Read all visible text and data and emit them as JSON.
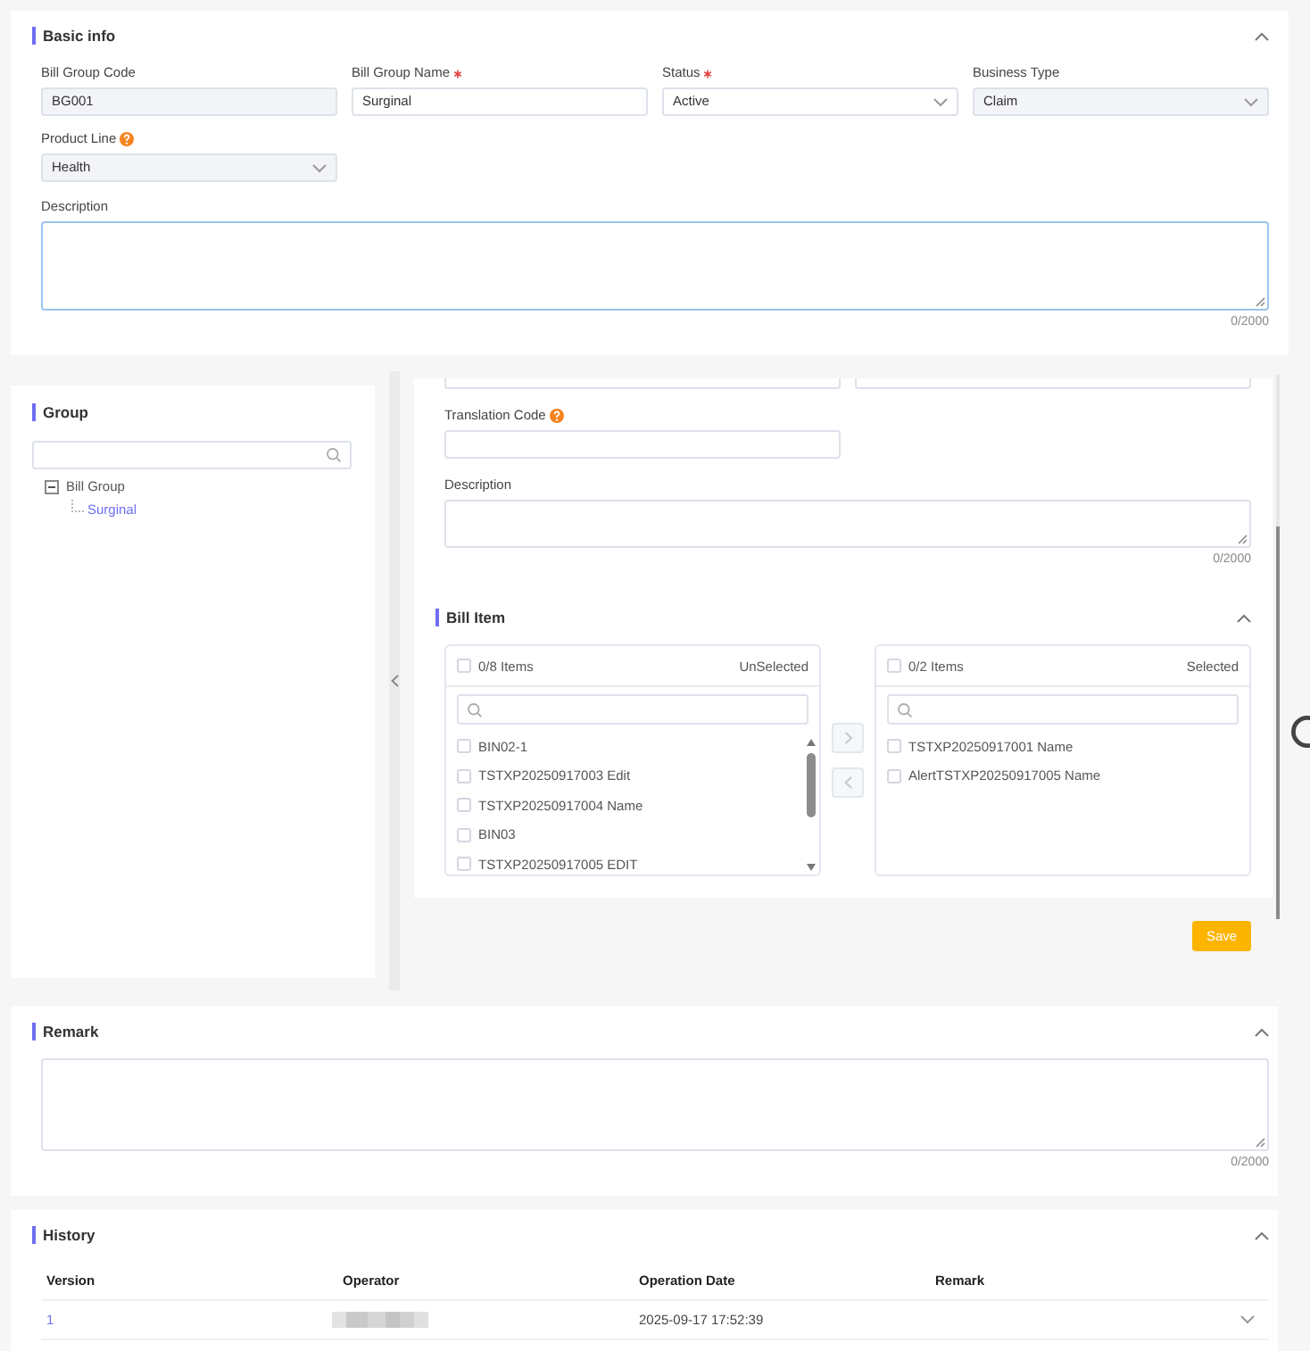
{
  "basic_info": {
    "title": "Basic info",
    "expanded": true,
    "fields": [
      {
        "kind": "input",
        "label": "Bill Group Code",
        "value": "BG001",
        "required": false,
        "help": false,
        "disabled": true
      },
      {
        "kind": "input",
        "label": "Bill Group Name",
        "value": "Surginal",
        "required": true,
        "help": false,
        "disabled": false
      },
      {
        "kind": "select",
        "label": "Status",
        "value": "Active",
        "required": true,
        "help": false,
        "disabled": false
      },
      {
        "kind": "select",
        "label": "Business Type",
        "value": "Claim",
        "required": false,
        "help": false,
        "disabled": true
      },
      {
        "kind": "select",
        "label": "Product Line",
        "value": "Health",
        "required": false,
        "help": true,
        "disabled": true
      }
    ],
    "description": {
      "label": "Description",
      "counter": "0/2000",
      "focused": true
    }
  },
  "group": {
    "title": "Group",
    "tree": [
      {
        "label": "Bill Group",
        "expanded": true,
        "selected": false,
        "children": [
          {
            "label": "Surginal",
            "selected": true
          }
        ]
      }
    ]
  },
  "detail": {
    "fields": [
      {
        "kind": "clipped_input"
      },
      {
        "kind": "clipped_input"
      },
      {
        "kind": "input",
        "label": "Translation Code",
        "required": false,
        "help": true,
        "disabled": false
      },
      {
        "kind": "textarea",
        "label": "Description",
        "counter": "0/2000",
        "focused": false
      }
    ],
    "bill_item": {
      "title": "Bill Item",
      "expanded": true,
      "source": {
        "count": "0/8 Items",
        "caption": "UnSelected",
        "checked": false,
        "scrollable": true,
        "items": [
          {
            "label": "BIN02-1",
            "checked": false
          },
          {
            "label": "TSTXP20250917003 Edit",
            "checked": false
          },
          {
            "label": "TSTXP20250917004 Name",
            "checked": false
          },
          {
            "label": "BIN03",
            "checked": false
          },
          {
            "label": "TSTXP20250917005 EDIT",
            "checked": false
          }
        ]
      },
      "target": {
        "count": "0/2 Items",
        "caption": "Selected",
        "checked": false,
        "scrollable": false,
        "items": [
          {
            "label": "TSTXP20250917001 Name",
            "checked": false
          },
          {
            "label": "AlertTSTXP20250917005 Name",
            "checked": false
          }
        ]
      },
      "move_buttons": [
        {
          "kind": "right",
          "disabled": true
        },
        {
          "kind": "left",
          "disabled": true
        }
      ]
    },
    "save_button": "Save"
  },
  "remark": {
    "title": "Remark",
    "expanded": true,
    "focused": false,
    "counter": "0/2000"
  },
  "history": {
    "title": "History",
    "expanded": true,
    "columns": [
      "Version",
      "Operator",
      "Operation Date",
      "Remark"
    ],
    "rows": [
      {
        "cells": [
          {
            "kind": "link",
            "text": "1"
          },
          {
            "kind": "redacted"
          },
          {
            "kind": "text",
            "text": "2025-09-17 17:52:39"
          }
        ],
        "expanded": false
      }
    ]
  }
}
